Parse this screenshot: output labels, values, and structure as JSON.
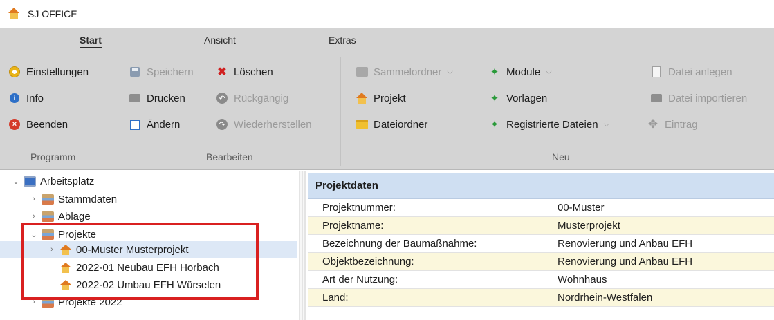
{
  "window": {
    "title": "SJ OFFICE",
    "icon": "house-icon"
  },
  "ribbon": {
    "tabs": [
      {
        "label": "Start",
        "active": true
      },
      {
        "label": "Ansicht",
        "active": false
      },
      {
        "label": "Extras",
        "active": false
      }
    ],
    "groups": {
      "programm": {
        "label": "Programm",
        "items": [
          {
            "label": "Einstellungen",
            "icon": "gear-icon",
            "enabled": true
          },
          {
            "label": "Info",
            "icon": "info-icon",
            "enabled": true
          },
          {
            "label": "Beenden",
            "icon": "exit-icon",
            "enabled": true
          }
        ]
      },
      "bearbeiten": {
        "label": "Bearbeiten",
        "items": [
          {
            "label": "Speichern",
            "icon": "save-icon",
            "enabled": false
          },
          {
            "label": "Drucken",
            "icon": "printer-icon",
            "enabled": true
          },
          {
            "label": "Ändern",
            "icon": "edit-icon",
            "enabled": true
          },
          {
            "label": "Löschen",
            "icon": "delete-icon",
            "enabled": true
          },
          {
            "label": "Rückgängig",
            "icon": "undo-icon",
            "enabled": false
          },
          {
            "label": "Wiederherstellen",
            "icon": "redo-icon",
            "enabled": false
          }
        ]
      },
      "neu": {
        "label": "Neu",
        "items": [
          {
            "label": "Sammelordner",
            "icon": "folder-stack-icon",
            "enabled": false,
            "dropdown": true
          },
          {
            "label": "Projekt",
            "icon": "house-icon",
            "enabled": true
          },
          {
            "label": "Dateiordner",
            "icon": "folder-icon",
            "enabled": true
          },
          {
            "label": "Module",
            "icon": "star-icon",
            "enabled": true,
            "dropdown": true
          },
          {
            "label": "Vorlagen",
            "icon": "star-icon",
            "enabled": true
          },
          {
            "label": "Registrierte Dateien",
            "icon": "star-icon",
            "enabled": true,
            "dropdown": true
          },
          {
            "label": "Eintrag",
            "icon": "plus-icon",
            "enabled": false
          },
          {
            "label": "Datei anlegen",
            "icon": "document-icon",
            "enabled": false
          },
          {
            "label": "Datei importieren",
            "icon": "import-icon",
            "enabled": false
          }
        ]
      }
    }
  },
  "tree": {
    "items": [
      {
        "label": "Arbeitsplatz",
        "icon": "computer-icon",
        "expanded": true
      },
      {
        "label": "Stammdaten",
        "icon": "shelf-icon",
        "expanded": false
      },
      {
        "label": "Ablage",
        "icon": "shelf-icon",
        "expanded": false
      },
      {
        "label": "Projekte",
        "icon": "shelf-icon",
        "expanded": true
      },
      {
        "label": "00-Muster Musterprojekt",
        "icon": "house-icon",
        "expanded": false,
        "selected": true
      },
      {
        "label": "2022-01 Neubau EFH Horbach",
        "icon": "house-icon"
      },
      {
        "label": "2022-02 Umbau EFH Würselen",
        "icon": "house-icon"
      },
      {
        "label": "Projekte 2022",
        "icon": "shelf-icon",
        "expanded": false
      }
    ]
  },
  "details": {
    "header": "Projektdaten",
    "rows": [
      {
        "label": "Projektnummer:",
        "value": "00-Muster"
      },
      {
        "label": "Projektname:",
        "value": "Musterprojekt"
      },
      {
        "label": "Bezeichnung der Baumaßnahme:",
        "value": "Renovierung und Anbau EFH"
      },
      {
        "label": "Objektbezeichnung:",
        "value": "Renovierung und Anbau EFH"
      },
      {
        "label": "Art der Nutzung:",
        "value": "Wohnhaus"
      },
      {
        "label": "Land:",
        "value": "Nordrhein-Westfalen"
      }
    ]
  },
  "colors": {
    "ribbon_bg": "#d4d4d4",
    "selection_bg": "#dde8f6",
    "detail_header_bg": "#cfdff2",
    "alt_row_bg": "#fbf7dc",
    "highlight_border": "#d92020"
  }
}
